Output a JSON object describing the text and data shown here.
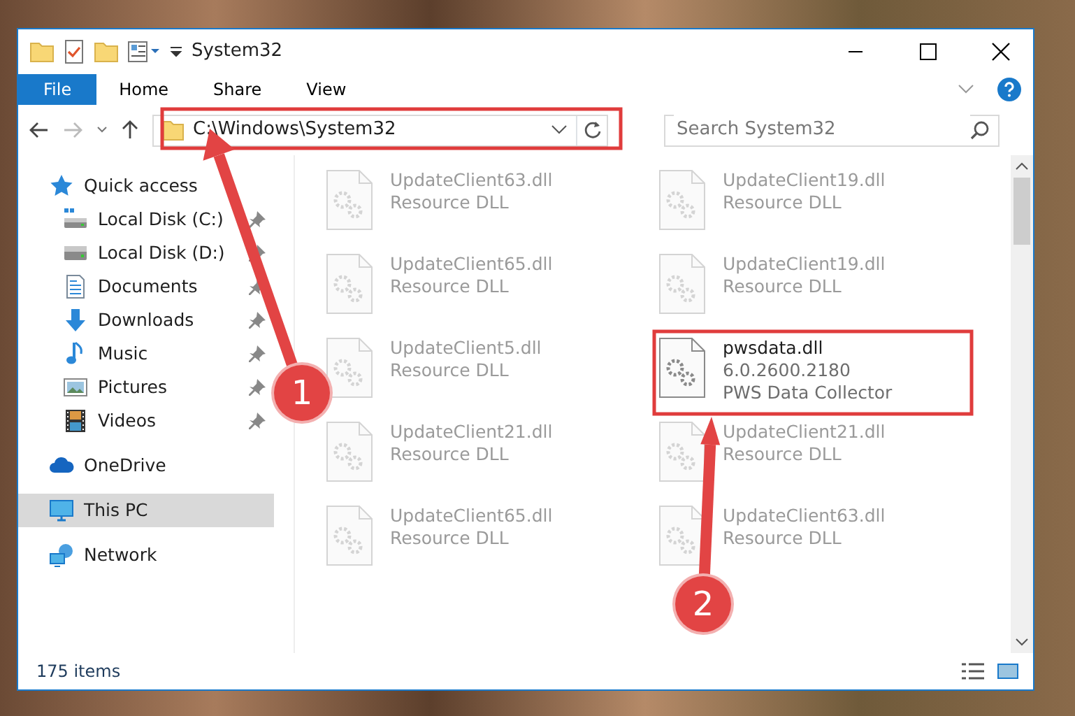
{
  "window": {
    "title": "System32"
  },
  "ribbon_tabs": [
    {
      "label": "File",
      "kind": "file"
    },
    {
      "label": "Home",
      "kind": "tab"
    },
    {
      "label": "Share",
      "kind": "tab"
    },
    {
      "label": "View",
      "kind": "tab"
    }
  ],
  "address": {
    "path": "C:\\Windows\\System32"
  },
  "search": {
    "placeholder": "Search System32"
  },
  "nav": {
    "items": [
      {
        "label": "Quick access",
        "kind": "star",
        "selected": false,
        "children": [
          {
            "label": "Local Disk (C:)",
            "kind": "system-drive",
            "pinned": true,
            "selected": false
          },
          {
            "label": "Local Disk (D:)",
            "kind": "drive",
            "pinned": true,
            "selected": false
          },
          {
            "label": "Documents",
            "kind": "documents",
            "pinned": true,
            "selected": false
          },
          {
            "label": "Downloads",
            "kind": "downloads",
            "pinned": true,
            "selected": false
          },
          {
            "label": "Music",
            "kind": "music",
            "pinned": true,
            "selected": false
          },
          {
            "label": "Pictures",
            "kind": "pictures",
            "pinned": true,
            "selected": false
          },
          {
            "label": "Videos",
            "kind": "videos",
            "pinned": true,
            "selected": false
          }
        ]
      },
      {
        "label": "OneDrive",
        "kind": "cloud",
        "selected": false
      },
      {
        "label": "This PC",
        "kind": "computer",
        "selected": true
      },
      {
        "label": "Network",
        "kind": "network",
        "selected": false
      }
    ]
  },
  "files": [
    {
      "name": "UpdateClient63.dll",
      "lines": [
        "Resource DLL"
      ],
      "blurred": true
    },
    {
      "name": "UpdateClient19.dll",
      "lines": [
        "Resource DLL"
      ],
      "blurred": true
    },
    {
      "name": "UpdateClient65.dll",
      "lines": [
        "Resource DLL"
      ],
      "blurred": true
    },
    {
      "name": "UpdateClient19.dll",
      "lines": [
        "Resource DLL"
      ],
      "blurred": true
    },
    {
      "name": "UpdateClient5.dll",
      "lines": [
        "Resource DLL"
      ],
      "blurred": true
    },
    {
      "name": "pwsdata.dll",
      "lines": [
        "6.0.2600.2180",
        "PWS Data Collector"
      ],
      "blurred": false
    },
    {
      "name": "UpdateClient21.dll",
      "lines": [
        "Resource DLL"
      ],
      "blurred": true
    },
    {
      "name": "UpdateClient21.dll",
      "lines": [
        "Resource DLL"
      ],
      "blurred": true
    },
    {
      "name": "UpdateClient65.dll",
      "lines": [
        "Resource DLL"
      ],
      "blurred": true
    },
    {
      "name": "UpdateClient63.dll",
      "lines": [
        "Resource DLL"
      ],
      "blurred": true
    }
  ],
  "status_bar": {
    "item_count": "175 items"
  },
  "annotations": [
    {
      "number": "1"
    },
    {
      "number": "2"
    }
  ]
}
